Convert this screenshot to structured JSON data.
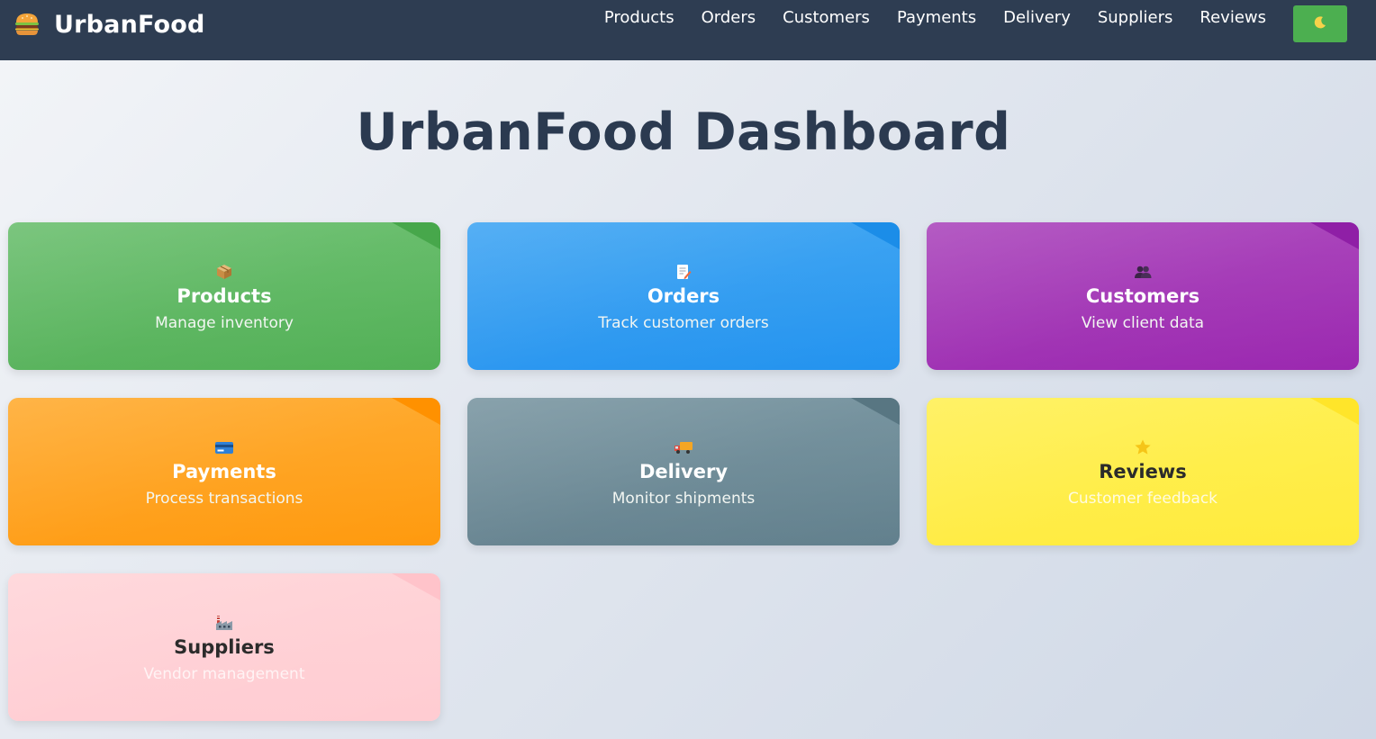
{
  "navbar": {
    "brand": "UrbanFood",
    "brand_icon": "burger-icon",
    "links": [
      "Products",
      "Orders",
      "Customers",
      "Payments",
      "Delivery",
      "Suppliers",
      "Reviews"
    ],
    "theme_toggle_icon": "moon-icon",
    "colors": {
      "background": "#2e3d52",
      "toggle": "#4caf50"
    }
  },
  "page": {
    "title": "UrbanFood Dashboard"
  },
  "cards": [
    {
      "title": "Products",
      "subtitle": "Manage inventory",
      "icon": "package-icon",
      "color": "#4caf50"
    },
    {
      "title": "Orders",
      "subtitle": "Track customer orders",
      "icon": "memo-icon",
      "color": "#2196f3"
    },
    {
      "title": "Customers",
      "subtitle": "View client data",
      "icon": "people-icon",
      "color": "#9c27b0"
    },
    {
      "title": "Payments",
      "subtitle": "Process transactions",
      "icon": "credit-card-icon",
      "color": "#ff9800"
    },
    {
      "title": "Delivery",
      "subtitle": "Monitor shipments",
      "icon": "truck-icon",
      "color": "#607d8b"
    },
    {
      "title": "Reviews",
      "subtitle": "Customer feedback",
      "icon": "star-icon",
      "color": "#ffeb3b"
    },
    {
      "title": "Suppliers",
      "subtitle": "Vendor management",
      "icon": "factory-icon",
      "color": "#ffcdd2"
    }
  ]
}
